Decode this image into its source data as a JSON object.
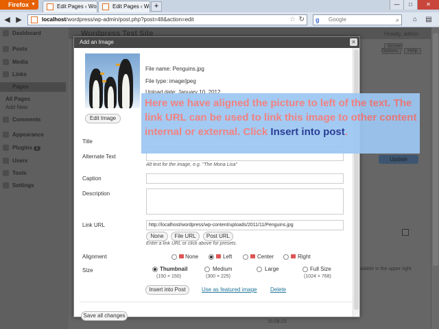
{
  "browser": {
    "menu_label": "Firefox",
    "tabs": [
      {
        "title": "Edit Pages ‹ Wordpress Test Site — Word..."
      },
      {
        "title": "Edit Pages ‹ Wordpress Test Site — Word..."
      }
    ],
    "new_tab": "+",
    "url_host": "localhost",
    "url_path": "/wordpress/wp-admin/post.php?post=48&action=edit",
    "search_placeholder": "Google"
  },
  "wp": {
    "site_title": "Wordpress Test Site",
    "howdy": "Howdy, admin",
    "screen_options": "Screen Options",
    "help": "Help",
    "menu": [
      "Dashboard",
      "Posts",
      "Media",
      "Links",
      "Pages",
      "All Pages",
      "Add New",
      "Comments",
      "Appearance",
      "Plugins",
      "Users",
      "Tools",
      "Settings"
    ],
    "plugins_badge": "1",
    "update_button": "Update",
    "side_note": "ailable in the upper right",
    "bottom_text": "15:08:23"
  },
  "modal": {
    "title": "Add an Image",
    "close": "×",
    "file_name": "File name: Penguins.jpg",
    "file_type": "File type: image/jpeg",
    "upload_date": "Upload date: January 10, 2012",
    "edit_image": "Edit Image",
    "labels": {
      "title": "Title",
      "alt": "Alternate Text",
      "caption": "Caption",
      "description": "Description",
      "link_url": "Link URL",
      "alignment": "Alignment",
      "size": "Size"
    },
    "alt_hint": "Alt text for the image, e.g. \"The Mona Lisa\"",
    "link_value": "http://localhost/wordpress/wp-content/uploads/2011/11/Penguins.jpg",
    "link_buttons": [
      "None",
      "File URL",
      "Post URL"
    ],
    "link_hint": "Enter a link URL or click above for presets.",
    "alignment": [
      {
        "label": "None",
        "selected": false,
        "color": "#cccccc"
      },
      {
        "label": "Left",
        "selected": true,
        "color": "#d55555"
      },
      {
        "label": "Center",
        "selected": false,
        "color": "#d55555"
      },
      {
        "label": "Right",
        "selected": false,
        "color": "#d55555"
      }
    ],
    "sizes": [
      {
        "label": "Thumbnail",
        "dims": "(150 × 150)",
        "selected": true
      },
      {
        "label": "Medium",
        "dims": "(300 × 225)",
        "selected": false
      },
      {
        "label": "Large",
        "dims": "",
        "selected": false
      },
      {
        "label": "Full Size",
        "dims": "(1024 × 768)",
        "selected": false
      }
    ],
    "insert_button": "Insert into Post",
    "featured_link": "Use as featured image",
    "delete_link": "Delete",
    "save_button": "Save all changes"
  },
  "callout": {
    "text_before": "Here we have aligned the picture to left of the text. The link URL can be used to link this image to other content internal or external. Click ",
    "highlight": "Insert into post",
    "text_after": ".",
    "bg_color": "#9cc7f2",
    "text_color": "#f17979",
    "highlight_color": "#1c2f8e"
  }
}
